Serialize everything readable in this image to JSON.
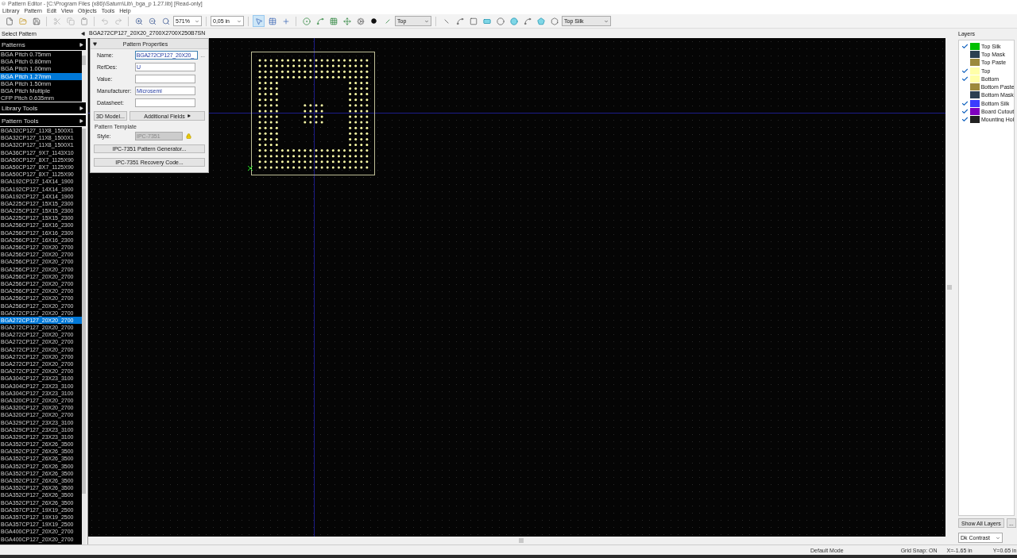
{
  "window": {
    "title": "Pattern Editor - [C:\\Program Files (x86)\\Saturn\\Lib\\_bga_p 1.27.lib] [Read-only]"
  },
  "menu": [
    "Library",
    "Pattern",
    "Edit",
    "View",
    "Objects",
    "Tools",
    "Help"
  ],
  "toolbar": {
    "zoom": "571%",
    "grid": "0,05 in",
    "side": "Top",
    "layer": "Top Silk",
    "mode_tools": [
      {
        "selected": true
      },
      {
        "selected": false
      },
      {
        "selected": false
      }
    ]
  },
  "left_panel": {
    "title": "Select Pattern",
    "patterns_header": "Patterns",
    "patterns": [
      {
        "label": "BGA Pitch 0.75mm",
        "selected": false
      },
      {
        "label": "BGA Pitch 0.80mm",
        "selected": false
      },
      {
        "label": "BGA Pitch 1.00mm",
        "selected": false
      },
      {
        "label": "BGA Pitch 1.27mm",
        "selected": true
      },
      {
        "label": "BGA Pitch 1.50mm",
        "selected": false
      },
      {
        "label": "BGA Pitch Multiple",
        "selected": false
      },
      {
        "label": "CFP Pitch 0.635mm",
        "selected": false
      }
    ],
    "library_tools_header": "Library Tools",
    "pattern_tools_header": "Pattern Tools",
    "pattern_list": [
      {
        "label": "BGA32CP127_11X8_1500X1",
        "selected": false
      },
      {
        "label": "BGA32CP127_11X8_1500X1",
        "selected": false
      },
      {
        "label": "BGA32CP127_11X8_1500X1",
        "selected": false
      },
      {
        "label": "BGA36CP127_9X7_1143X10",
        "selected": false
      },
      {
        "label": "BGA50CP127_8X7_1125X90",
        "selected": false
      },
      {
        "label": "BGA50CP127_8X7_1125X90",
        "selected": false
      },
      {
        "label": "BGA50CP127_8X7_1125X90",
        "selected": false
      },
      {
        "label": "BGA192CP127_14X14_1900",
        "selected": false
      },
      {
        "label": "BGA192CP127_14X14_1900",
        "selected": false
      },
      {
        "label": "BGA192CP127_14X14_1900",
        "selected": false
      },
      {
        "label": "BGA225CP127_15X15_2300",
        "selected": false
      },
      {
        "label": "BGA225CP127_15X15_2300",
        "selected": false
      },
      {
        "label": "BGA225CP127_15X15_2300",
        "selected": false
      },
      {
        "label": "BGA256CP127_16X16_2300",
        "selected": false
      },
      {
        "label": "BGA256CP127_16X16_2300",
        "selected": false
      },
      {
        "label": "BGA256CP127_16X16_2300",
        "selected": false
      },
      {
        "label": "BGA256CP127_20X20_2700",
        "selected": false
      },
      {
        "label": "BGA256CP127_20X20_2700",
        "selected": false
      },
      {
        "label": "BGA256CP127_20X20_2700",
        "selected": false
      },
      {
        "label": "BGA256CP127_20X20_2700",
        "selected": false
      },
      {
        "label": "BGA256CP127_20X20_2700",
        "selected": false
      },
      {
        "label": "BGA256CP127_20X20_2700",
        "selected": false
      },
      {
        "label": "BGA256CP127_20X20_2700",
        "selected": false
      },
      {
        "label": "BGA256CP127_20X20_2700",
        "selected": false
      },
      {
        "label": "BGA256CP127_20X20_2700",
        "selected": false
      },
      {
        "label": "BGA272CP127_20X20_2700",
        "selected": false
      },
      {
        "label": "BGA272CP127_20X20_2700",
        "selected": true
      },
      {
        "label": "BGA272CP127_20X20_2700",
        "selected": false
      },
      {
        "label": "BGA272CP127_20X20_2700",
        "selected": false
      },
      {
        "label": "BGA272CP127_20X20_2700",
        "selected": false
      },
      {
        "label": "BGA272CP127_20X20_2700",
        "selected": false
      },
      {
        "label": "BGA272CP127_20X20_2700",
        "selected": false
      },
      {
        "label": "BGA272CP127_20X20_2700",
        "selected": false
      },
      {
        "label": "BGA272CP127_20X20_2700",
        "selected": false
      },
      {
        "label": "BGA304CP127_23X23_3100",
        "selected": false
      },
      {
        "label": "BGA304CP127_23X23_3100",
        "selected": false
      },
      {
        "label": "BGA304CP127_23X23_3100",
        "selected": false
      },
      {
        "label": "BGA320CP127_20X20_2700",
        "selected": false
      },
      {
        "label": "BGA320CP127_20X20_2700",
        "selected": false
      },
      {
        "label": "BGA320CP127_20X20_2700",
        "selected": false
      },
      {
        "label": "BGA329CP127_23X23_3100",
        "selected": false
      },
      {
        "label": "BGA329CP127_23X23_3100",
        "selected": false
      },
      {
        "label": "BGA329CP127_23X23_3100",
        "selected": false
      },
      {
        "label": "BGA352CP127_26X26_3500",
        "selected": false
      },
      {
        "label": "BGA352CP127_26X26_3500",
        "selected": false
      },
      {
        "label": "BGA352CP127_26X26_3500",
        "selected": false
      },
      {
        "label": "BGA352CP127_26X26_3500",
        "selected": false
      },
      {
        "label": "BGA352CP127_26X26_3500",
        "selected": false
      },
      {
        "label": "BGA352CP127_26X26_3500",
        "selected": false
      },
      {
        "label": "BGA352CP127_26X26_3500",
        "selected": false
      },
      {
        "label": "BGA352CP127_26X26_3500",
        "selected": false
      },
      {
        "label": "BGA352CP127_26X26_3500",
        "selected": false
      },
      {
        "label": "BGA357CP127_19X19_2500",
        "selected": false
      },
      {
        "label": "BGA357CP127_19X19_2500",
        "selected": false
      },
      {
        "label": "BGA357CP127_19X19_2500",
        "selected": false
      },
      {
        "label": "BGA400CP127_20X20_2700",
        "selected": false
      },
      {
        "label": "BGA400CP127_20X20_2700",
        "selected": false
      }
    ]
  },
  "editor": {
    "pattern_title": "BGA272CP127_20X20_2700X2700X250B7SN",
    "properties": {
      "title": "Pattern Properties",
      "fields": [
        {
          "label": "Name:",
          "value": "BGA272CP127_20X20_",
          "browse": "..."
        },
        {
          "label": "RefDes:",
          "value": "U"
        },
        {
          "label": "Value:"
        },
        {
          "label": "Manufacturer:",
          "value": "Microsemi"
        },
        {
          "label": "Datasheet:"
        }
      ],
      "model_button": "3D Model...",
      "fields_button": "Additional Fields",
      "template_title": "Pattern Template",
      "style_label": "Style:",
      "style_value": "IPC-7351",
      "style_disabled": true,
      "buttons": [
        "IPC-7351 Pattern Generator...",
        "IPC-7351 Recovery Code..."
      ]
    }
  },
  "layers": {
    "title": "Layers",
    "items": [
      {
        "name": "Top Silk",
        "checked": true,
        "color": "#00c000"
      },
      {
        "name": "Top Mask",
        "checked": false,
        "color": "#2b4050"
      },
      {
        "name": "Top Paste",
        "checked": false,
        "color": "#9c8a3c"
      },
      {
        "name": "Top",
        "checked": true,
        "color": "#ffffa8"
      },
      {
        "name": "Bottom",
        "checked": true,
        "color": "#ffffa8"
      },
      {
        "name": "Bottom Paste",
        "checked": false,
        "color": "#9c8a3c"
      },
      {
        "name": "Bottom Mask",
        "checked": false,
        "color": "#2b4050"
      },
      {
        "name": "Bottom Silk",
        "checked": true,
        "color": "#3c3cff"
      },
      {
        "name": "Board Cutout",
        "checked": true,
        "color": "#8000c0"
      },
      {
        "name": "Mounting Hol",
        "checked": true,
        "color": "#222222"
      }
    ],
    "show_all": "Show All Layers",
    "more": "...",
    "scheme": "Dk Contrast"
  },
  "status_bar": {
    "mode": "Default Mode",
    "grid_snap": "Grid Snap: ON",
    "x": "X=-1.65 in",
    "y": "Y=0.65 in"
  }
}
